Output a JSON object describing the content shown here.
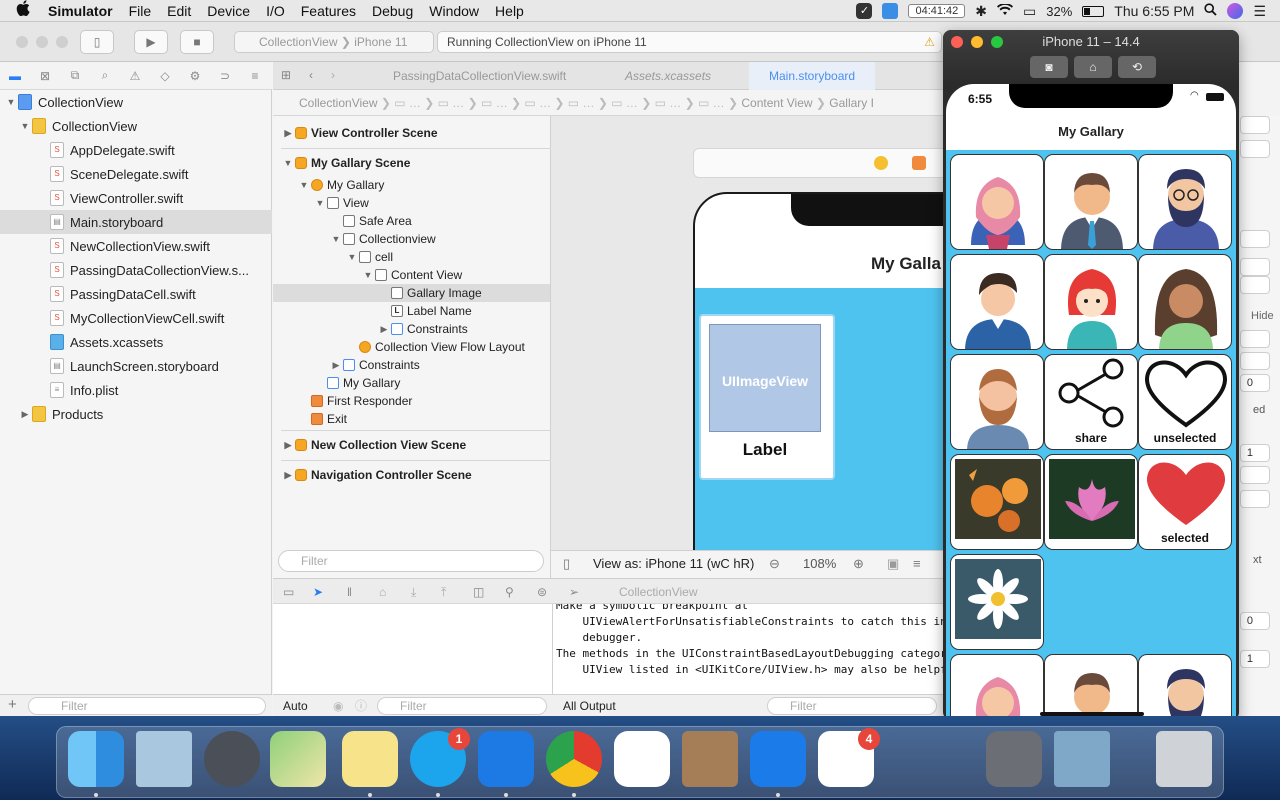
{
  "menubar": {
    "app": "Simulator",
    "items": [
      "File",
      "Edit",
      "Device",
      "I/O",
      "Features",
      "Debug",
      "Window",
      "Help"
    ],
    "timer": "04:41:42",
    "battery": "32%",
    "clock": "Thu 6:55 PM"
  },
  "toolbar": {
    "scheme_project": "CollectionView",
    "scheme_device": "iPhone 11",
    "activity": "Running CollectionView on iPhone 11"
  },
  "navigator": {
    "rows": [
      {
        "label": "CollectionView",
        "type": "proj"
      },
      {
        "label": "CollectionView",
        "type": "folder"
      },
      {
        "label": "AppDelegate.swift",
        "type": "swift"
      },
      {
        "label": "SceneDelegate.swift",
        "type": "swift"
      },
      {
        "label": "ViewController.swift",
        "type": "swift"
      },
      {
        "label": "Main.storyboard",
        "type": "storyboard"
      },
      {
        "label": "NewCollectionView.swift",
        "type": "swift"
      },
      {
        "label": "PassingDataCollectionView.s...",
        "type": "swift"
      },
      {
        "label": "PassingDataCell.swift",
        "type": "swift"
      },
      {
        "label": "MyCollectionViewCell.swift",
        "type": "swift"
      },
      {
        "label": "Assets.xcassets",
        "type": "assets"
      },
      {
        "label": "LaunchScreen.storyboard",
        "type": "storyboard"
      },
      {
        "label": "Info.plist",
        "type": "plist"
      },
      {
        "label": "Products",
        "type": "folder"
      }
    ],
    "filter_placeholder": "Filter"
  },
  "tabs": [
    "PassingDataCollectionView.swift",
    "Assets.xcassets",
    "Main.storyboard"
  ],
  "jumpbar": {
    "crumbs": [
      "CollectionView",
      "Content View",
      "Gallary I"
    ]
  },
  "outline": {
    "rows": [
      "View Controller Scene",
      "My Gallary Scene",
      "My Gallary",
      "View",
      "Safe Area",
      "Collectionview",
      "cell",
      "Content View",
      "Gallary Image",
      "Label Name",
      "Constraints",
      "Collection View Flow Layout",
      "Constraints",
      "My Gallary",
      "First Responder",
      "Exit",
      "New Collection View Scene",
      "Navigation Controller Scene"
    ],
    "filter_placeholder": "Filter"
  },
  "canvas": {
    "nav_title": "My Galla",
    "image_placeholder": "UIImageView",
    "label": "Label",
    "view_as": "View as: iPhone 11 (wC hR)",
    "zoom": "108%"
  },
  "debug": {
    "target": "CollectionView",
    "console_lines": [
      "Make a symbolic breakpoint at",
      "    UIViewAlertForUnsatisfiableConstraints to catch this in the",
      "    debugger.",
      "The methods in the UIConstraintBasedLayoutDebugging category on",
      "    UIView listed in <UIKitCore/UIView.h> may also be helpful."
    ],
    "auto": "Auto",
    "all_output": "All Output",
    "filter_placeholder": "Filter"
  },
  "inspector": {
    "hide": "Hide",
    "values": [
      "0",
      "1",
      "0",
      "1"
    ],
    "ed": "ed",
    "xt": "xt"
  },
  "simulator": {
    "title": "iPhone 11 – 14.4",
    "time": "6:55",
    "nav_title": "My Gallary",
    "captions": {
      "share": "share",
      "unselected": "unselected",
      "selected": "selected"
    }
  },
  "dock": {
    "badges": {
      "skype": "1",
      "reminders": "4"
    }
  },
  "colors": {
    "accent": "#2a7df5",
    "sim_background": "#4fc3ef",
    "heart": "#e03b3f"
  }
}
